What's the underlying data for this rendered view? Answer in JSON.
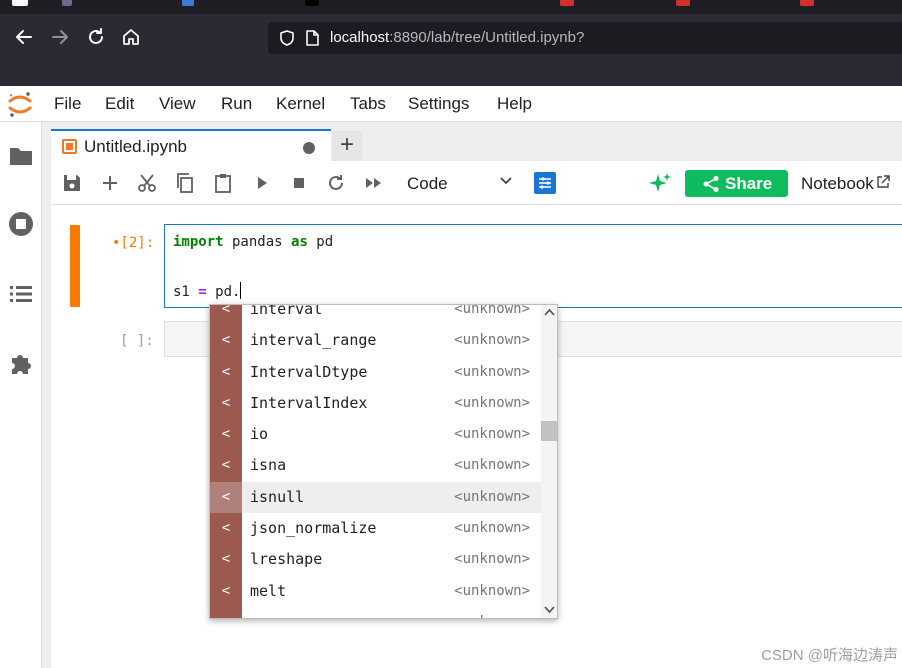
{
  "browser": {
    "url_host": "localhost",
    "url_rest": ":8890/lab/tree/Untitled.ipynb?",
    "icons": [
      "back-arrow-icon",
      "forward-arrow-icon",
      "reload-icon",
      "home-icon",
      "shield-icon",
      "page-icon"
    ]
  },
  "menubar": {
    "items": [
      "File",
      "Edit",
      "View",
      "Run",
      "Kernel",
      "Tabs",
      "Settings",
      "Help"
    ]
  },
  "sidebar": {
    "icons": [
      "folder-icon",
      "running-stop-icon",
      "table-of-contents-icon",
      "extension-puzzle-icon"
    ]
  },
  "document_tab": {
    "title": "Untitled.ipynb",
    "new_tab": "+"
  },
  "notebook_toolbar": {
    "cell_type": "Code",
    "share_label": "Share",
    "notebook_label": "Notebook",
    "icons": [
      "save-icon",
      "add-cell-icon",
      "cut-icon",
      "copy-icon",
      "paste-icon",
      "run-icon",
      "stop-icon",
      "restart-icon",
      "fast-forward-icon",
      "property-inspector-icon",
      "ai-sparkle-icon",
      "share-icon",
      "external-link-icon"
    ]
  },
  "cells": {
    "cell1": {
      "prompt": "•[2]:",
      "line1": {
        "kw1": "import",
        "mod": " pandas ",
        "kw2": "as",
        "alias": " pd"
      },
      "line2": {
        "var": "s1 ",
        "op": "=",
        "rest": " pd."
      }
    },
    "cell2": {
      "prompt": "[ ]:"
    }
  },
  "completer": {
    "items": [
      {
        "type": "<",
        "name": "interval",
        "desc": "<unknown>"
      },
      {
        "type": "<",
        "name": "interval_range",
        "desc": "<unknown>"
      },
      {
        "type": "<",
        "name": "IntervalDtype",
        "desc": "<unknown>"
      },
      {
        "type": "<",
        "name": "IntervalIndex",
        "desc": "<unknown>"
      },
      {
        "type": "<",
        "name": "io",
        "desc": "<unknown>"
      },
      {
        "type": "<",
        "name": "isna",
        "desc": "<unknown>"
      },
      {
        "type": "<",
        "name": "isnull",
        "desc": "<unknown>"
      },
      {
        "type": "<",
        "name": "json_normalize",
        "desc": "<unknown>"
      },
      {
        "type": "<",
        "name": "lreshape",
        "desc": "<unknown>"
      },
      {
        "type": "<",
        "name": "melt",
        "desc": "<unknown>"
      },
      {
        "type": "<",
        "name": "merge",
        "desc": "<unknown>"
      }
    ],
    "active_index": 6
  },
  "watermark": "CSDN @听海边涛声",
  "colors": {
    "accent": "#1976d2",
    "cell_active": "#f57c00",
    "share_green": "#0ebc5d",
    "completer_type_bg": "#9c5a4f"
  }
}
